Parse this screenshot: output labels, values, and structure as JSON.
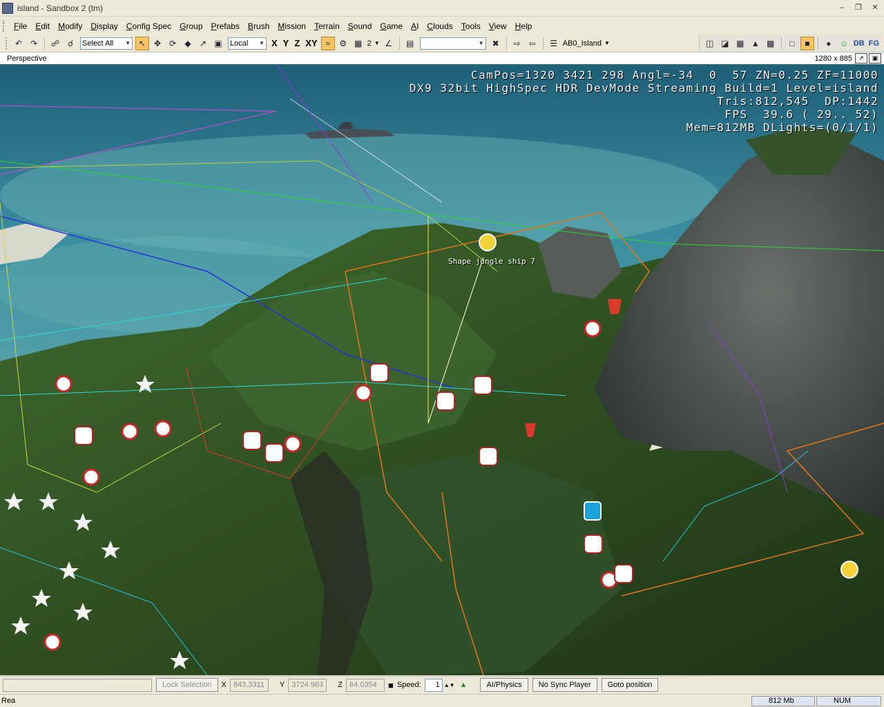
{
  "window": {
    "title": "island - Sandbox 2 (tm)"
  },
  "menu": [
    "File",
    "Edit",
    "Modify",
    "Display",
    "Config Spec",
    "Group",
    "Prefabs",
    "Brush",
    "Mission",
    "Terrain",
    "Sound",
    "Game",
    "AI",
    "Clouds",
    "Tools",
    "View",
    "Help"
  ],
  "toolbar": {
    "selection_filter": "Select All",
    "coord_system": "Local",
    "axis_x": "X",
    "axis_y": "Y",
    "axis_z": "Z",
    "axis_xy": "XY",
    "grid_value": "2",
    "layer_name": "AB0_Island",
    "db_label": "DB",
    "fg_label": "FG"
  },
  "viewport": {
    "name": "Perspective",
    "size": "1280 x 885",
    "hud": [
      "CamPos=1320 3421 298 Angl=-34  0  57 ZN=0.25 ZF=11000",
      "DX9 32bit HighSpec HDR DevMode Streaming Build=1 Level=island",
      "Tris:812,545  DP:1442",
      "FPS  39.6 ( 29.. 52)",
      "Mem=812MB DLights=(0/1/1)"
    ],
    "object_label": "Shape jungle ship 7"
  },
  "controls": {
    "lock_selection": "Lock Selection",
    "x_label": "X",
    "x_value": "843.3311",
    "y_label": "Y",
    "y_value": "3724.963",
    "z_label": "Z",
    "z_value": "64.0354",
    "speed_label": "Speed:",
    "speed_value": "1",
    "ai_physics": "AI/Physics",
    "no_sync_player": "No Sync Player",
    "goto_position": "Goto position"
  },
  "status": {
    "text": "Rea",
    "memory": "812 Mb",
    "num": "NUM"
  },
  "colors": {
    "sea": "#2f7f95",
    "jungle": "#2f4a22",
    "rock": "#4c5552"
  }
}
